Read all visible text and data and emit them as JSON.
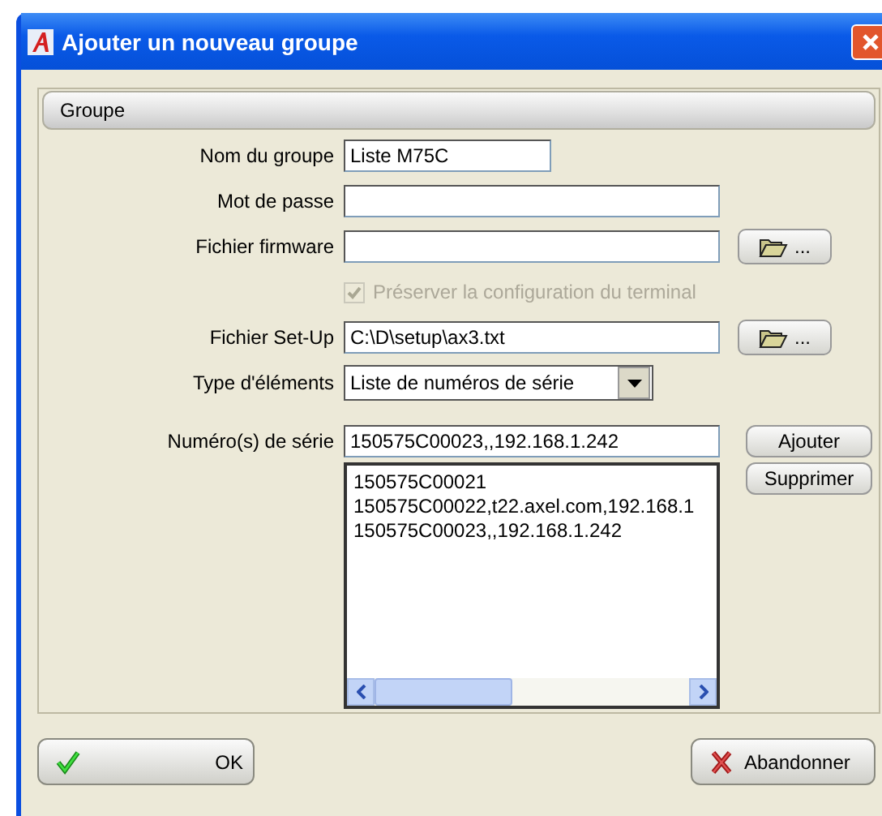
{
  "window": {
    "title": "Ajouter un nouveau groupe"
  },
  "section": {
    "title": "Groupe"
  },
  "fields": [
    {
      "kind": "short_text",
      "label": "Nom du groupe",
      "value": "Liste M75C"
    },
    {
      "kind": "text",
      "label": "Mot de passe"
    },
    {
      "kind": "file",
      "label": "Fichier firmware",
      "browse": "..."
    },
    {
      "kind": "checkbox",
      "label": "Préserver la configuration du terminal",
      "checked": true,
      "disabled": true
    },
    {
      "kind": "file",
      "label": "Fichier Set-Up",
      "value": "C:\\D\\setup\\ax3.txt",
      "browse": "..."
    },
    {
      "kind": "select",
      "label": "Type d'éléments",
      "value": "Liste de numéros de série"
    }
  ],
  "serials": {
    "label": "Numéro(s) de série",
    "value": "150575C00023,,192.168.1.242",
    "add_button": "Ajouter",
    "remove_button": "Supprimer",
    "items": [
      "150575C00021",
      "150575C00022,t22.axel.com,192.168.1",
      "150575C00023,,192.168.1.242"
    ]
  },
  "buttons": [
    {
      "kind": "ok",
      "label": "OK"
    },
    {
      "kind": "cancel",
      "label": "Abandonner"
    }
  ]
}
